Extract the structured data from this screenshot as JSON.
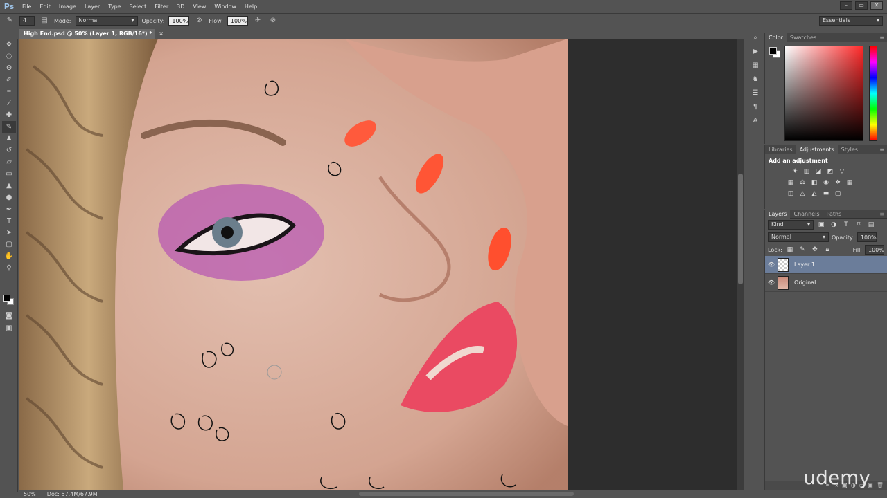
{
  "app": {
    "logo": "Ps"
  },
  "menu": [
    "File",
    "Edit",
    "Image",
    "Layer",
    "Type",
    "Select",
    "Filter",
    "3D",
    "View",
    "Window",
    "Help"
  ],
  "window_controls": [
    "–",
    "▭",
    "✕"
  ],
  "options": {
    "brush_size": "4",
    "mode_label": "Mode:",
    "mode_value": "Normal",
    "opacity_label": "Opacity:",
    "opacity_value": "100%",
    "flow_label": "Flow:",
    "flow_value": "100%",
    "workspace": "Essentials"
  },
  "document": {
    "tab_title": "High End.psd @ 50% (Layer 1, RGB/16*) *",
    "close": "×"
  },
  "status": {
    "zoom": "50%",
    "doc_size": "Doc: 57.4M/67.9M"
  },
  "color_panel": {
    "tabs": [
      "Color",
      "Swatches"
    ],
    "active": 0
  },
  "adjustments_panel": {
    "tabs": [
      "Libraries",
      "Adjustments",
      "Styles"
    ],
    "active": 1,
    "title": "Add an adjustment"
  },
  "layers_panel": {
    "tabs": [
      "Layers",
      "Channels",
      "Paths"
    ],
    "active": 0,
    "filter": "Kind",
    "blend_mode": "Normal",
    "opacity_label": "Opacity:",
    "opacity_value": "100%",
    "lock_label": "Lock:",
    "fill_label": "Fill:",
    "fill_value": "100%",
    "layers": [
      {
        "name": "Layer 1",
        "selected": true
      },
      {
        "name": "Original",
        "selected": false
      }
    ]
  },
  "watermark": "udemy"
}
